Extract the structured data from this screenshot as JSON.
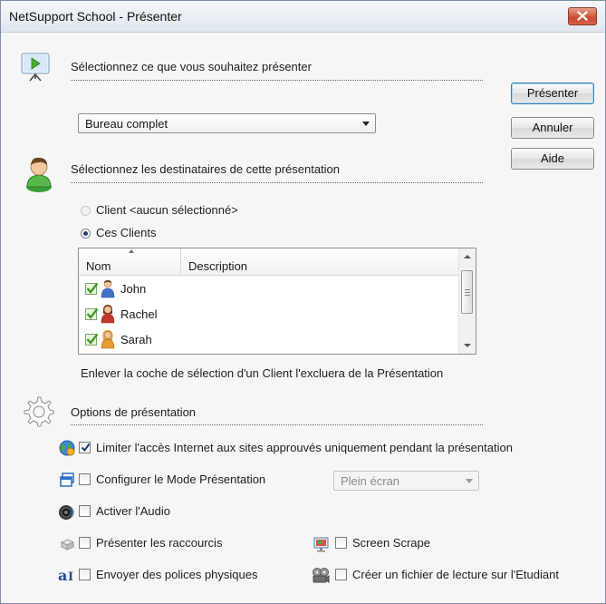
{
  "window": {
    "title": "NetSupport School - Présenter"
  },
  "section_present": {
    "title": "Sélectionnez ce que vous souhaitez présenter"
  },
  "source_select": {
    "value": "Bureau complet"
  },
  "buttons": {
    "present": "Présenter",
    "cancel": "Annuler",
    "help": "Aide"
  },
  "section_recipients": {
    "title": "Sélectionnez les destinataires de cette présentation"
  },
  "recipients": {
    "client_option": "Client <aucun sélectionné>",
    "these_clients_option": "Ces Clients",
    "selected": "these_clients"
  },
  "client_list": {
    "columns": [
      "Nom",
      "Description"
    ],
    "rows": [
      {
        "name": "John",
        "description": "",
        "checked": true,
        "avatar_color": "#3f74c9"
      },
      {
        "name": "Rachel",
        "description": "",
        "checked": true,
        "avatar_color": "#c0392b"
      },
      {
        "name": "Sarah",
        "description": "",
        "checked": true,
        "avatar_color": "#e59b2e"
      }
    ]
  },
  "uncheck_note": "Enlever la coche de sélection d'un Client l'excluera de la Présentation",
  "section_options": {
    "title": "Options de présentation"
  },
  "options": {
    "limit_internet": {
      "label": "Limiter l'accès Internet aux sites approuvés uniquement pendant la présentation",
      "checked": true,
      "icon": "internet-globe-icon"
    },
    "present_mode": {
      "label": "Configurer le Mode Présentation",
      "checked": false,
      "icon": "present-mode-icon"
    },
    "present_mode_select": {
      "value": "Plein écran",
      "enabled": false
    },
    "audio": {
      "label": "Activer l'Audio",
      "checked": false,
      "icon": "speaker-icon"
    },
    "shortcuts": {
      "label": "Présenter les raccourcis",
      "checked": false,
      "icon": "shortcut-icon"
    },
    "screen_scrape": {
      "label": "Screen Scrape",
      "checked": false,
      "icon": "screen-scrape-icon"
    },
    "physical_fonts": {
      "label": "Envoyer des polices physiques",
      "checked": false,
      "icon": "font-icon"
    },
    "replay_file": {
      "label": "Créer un fichier de lecture sur l'Etudiant",
      "checked": false,
      "icon": "film-reel-icon"
    }
  }
}
